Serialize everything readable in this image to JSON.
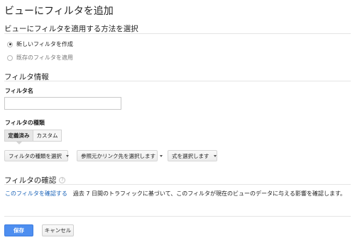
{
  "page": {
    "title": "ビューにフィルタを追加"
  },
  "method_section": {
    "title": "ビューにフィルタを適用する方法を選択",
    "options": [
      {
        "label": "新しいフィルタを作成",
        "checked": true
      },
      {
        "label": "既存のフィルタを適用",
        "checked": false
      }
    ]
  },
  "info_section": {
    "title": "フィルタ情報",
    "name_label": "フィルタ名",
    "name_value": "",
    "type_label": "フィルタの種類",
    "tabs": [
      {
        "label": "定義済み",
        "active": true
      },
      {
        "label": "カスタム",
        "active": false
      }
    ],
    "dropdowns": [
      {
        "label": "フィルタの種類を選択"
      },
      {
        "label": "参照元かリンク先を選択します"
      },
      {
        "label": "式を選択します"
      }
    ]
  },
  "verify_section": {
    "title": "フィルタの確認",
    "help_icon": "?",
    "link_text": "このフィルタを確認する",
    "description": "過去 7 日間のトラフィックに基づいて、このフィルタが現在のビューのデータに与える影響を確認します。"
  },
  "actions": {
    "save_label": "保存",
    "cancel_label": "キャンセル"
  },
  "colors": {
    "link": "#1a63b8",
    "primary_button": "#4d8ef0"
  }
}
